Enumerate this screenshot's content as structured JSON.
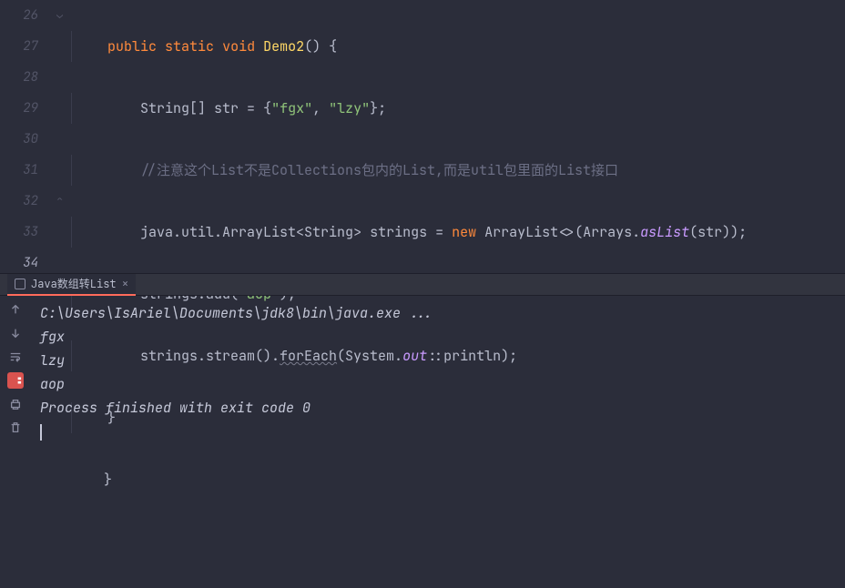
{
  "lines": [
    {
      "n": "26"
    },
    {
      "n": "27"
    },
    {
      "n": "28"
    },
    {
      "n": "29"
    },
    {
      "n": "30"
    },
    {
      "n": "31"
    },
    {
      "n": "32"
    },
    {
      "n": "33"
    },
    {
      "n": "34",
      "current": true
    }
  ],
  "code": {
    "l26": {
      "kw1": "public",
      "kw2": "static",
      "kw3": "void",
      "name": "Demo2",
      "paren": "()",
      "brace": " {"
    },
    "l27": {
      "t1": "String[] str ",
      "op": "=",
      "t2": " {",
      "s1": "\"fgx\"",
      "c": ", ",
      "s2": "\"lzy\"",
      "t3": "};"
    },
    "l28": {
      "cmt": "//注意这个List不是Collections包内的List,而是util包里面的List接口"
    },
    "l29": {
      "p": "java.util.ArrayList",
      "lt": "<",
      "g": "String",
      "gt": ">",
      "v": " strings ",
      "op": "=",
      "sp": " ",
      "nw": "new",
      "t2": " ArrayList<>(Arrays.",
      "m": "asList",
      "t3": "(str));"
    },
    "l30": {
      "t1": "strings.add(",
      "s": "\"aop\"",
      "t2": ");"
    },
    "l31": {
      "t1": "strings.stream().",
      "m": "forEach",
      "t2": "(System.",
      "f": "out",
      "t3": "::println);"
    },
    "l32": {
      "b": "}"
    },
    "l33": {
      "b": "}"
    }
  },
  "tab": {
    "label": "Java数组转List"
  },
  "output": {
    "cmd": "C:\\Users\\IsAriel\\Documents\\jdk8\\bin\\java.exe ...",
    "l1": "fgx",
    "l2": "lzy",
    "l3": "aop",
    "exit": "Process finished with exit code 0"
  }
}
